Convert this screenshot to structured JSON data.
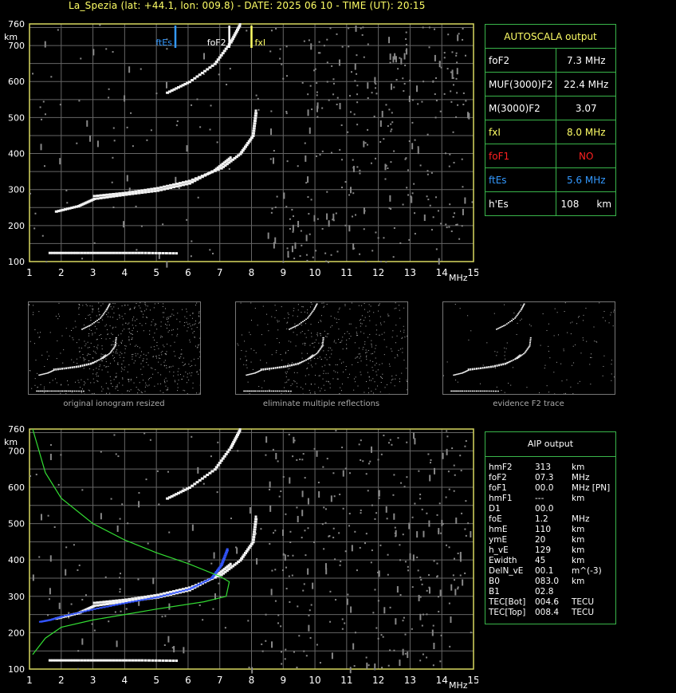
{
  "header": {
    "title": "La_Spezia (lat: +44.1, lon: 009.8) - DATE: 2025 06 10 - TIME (UT): 20:15"
  },
  "autoscala": {
    "heading": "AUTOSCALA output",
    "rows": [
      {
        "label": "foF2",
        "value": "7.3 MHz",
        "color": "#ffffff"
      },
      {
        "label": "MUF(3000)F2",
        "value": "22.4 MHz",
        "color": "#ffffff"
      },
      {
        "label": "M(3000)F2",
        "value": "3.07",
        "color": "#ffffff"
      },
      {
        "label": "fxI",
        "value": "8.0 MHz",
        "color": "#ffff66"
      },
      {
        "label": "foF1",
        "value": "NO",
        "color": "#ff2020"
      },
      {
        "label": "ftEs",
        "value": "5.6 MHz",
        "color": "#3399ff"
      },
      {
        "label": "h'Es",
        "value": "108",
        "unit": "km",
        "color": "#ffffff"
      }
    ]
  },
  "aip": {
    "heading": "AIP output",
    "rows": [
      {
        "name": "hmF2",
        "value": "313",
        "unit": "km"
      },
      {
        "name": "foF2",
        "value": "07.3",
        "unit": "MHz"
      },
      {
        "name": "foF1",
        "value": "00.0",
        "unit": "MHz   [PN]"
      },
      {
        "name": "hmF1",
        "value": "---",
        "unit": "km"
      },
      {
        "name": "D1",
        "value": "00.0",
        "unit": ""
      },
      {
        "name": "foE",
        "value": "1.2",
        "unit": "MHz"
      },
      {
        "name": "hmE",
        "value": "110",
        "unit": "km"
      },
      {
        "name": "ymE",
        "value": "20",
        "unit": "km"
      },
      {
        "name": "h_vE",
        "value": "129",
        "unit": "km"
      },
      {
        "name": "Ewidth",
        "value": "45",
        "unit": "km"
      },
      {
        "name": "DelN_vE",
        "value": "00.1",
        "unit": "m^(-3)"
      },
      {
        "name": "B0",
        "value": "083.0",
        "unit": "km"
      },
      {
        "name": "B1",
        "value": "02.8",
        "unit": ""
      },
      {
        "name": "TEC[Bot]",
        "value": "004.6",
        "unit": "TECU"
      },
      {
        "name": "TEC[Top]",
        "value": "008.4",
        "unit": "TECU"
      }
    ]
  },
  "thumbnails": {
    "captions": [
      "original ionogram resized",
      "eliminate multiple reflections",
      "evidence F2 trace"
    ]
  },
  "chart_data": [
    {
      "type": "scatter",
      "title": "",
      "xlabel": "MHz",
      "ylabel": "km",
      "xlim": [
        1,
        15
      ],
      "ylim": [
        100,
        760
      ],
      "x_ticks": [
        1,
        2,
        3,
        4,
        5,
        6,
        7,
        8,
        9,
        10,
        11,
        12,
        13,
        14,
        15
      ],
      "y_ticks": [
        100,
        200,
        300,
        400,
        500,
        600,
        700,
        760
      ],
      "grid": true,
      "annotations": [
        {
          "label": "ftEs",
          "x": 5.6,
          "color": "#3399ff"
        },
        {
          "label": "foF2",
          "x": 7.3,
          "color": "#ffffff"
        },
        {
          "label": "fxI",
          "x": 8.0,
          "color": "#ffff66"
        }
      ],
      "series": [
        {
          "values": [
            [
              1.6,
              125
            ],
            [
              2.5,
              125
            ],
            [
              3.5,
              125
            ],
            [
              4.5,
              125
            ],
            [
              5.6,
              124
            ]
          ]
        },
        {
          "values": [
            [
              1.8,
              240
            ],
            [
              2.5,
              255
            ],
            [
              3,
              275
            ],
            [
              4,
              287
            ],
            [
              5,
              298
            ],
            [
              6,
              318
            ],
            [
              6.8,
              355
            ],
            [
              7.3,
              390
            ]
          ]
        },
        {
          "values": [
            [
              3,
              283
            ],
            [
              4,
              292
            ],
            [
              5,
              305
            ],
            [
              6,
              325
            ],
            [
              7,
              360
            ],
            [
              7.6,
              400
            ],
            [
              8,
              450
            ],
            [
              8.1,
              520
            ]
          ]
        },
        {
          "values": [
            [
              5.3,
              570
            ],
            [
              6,
              600
            ],
            [
              6.8,
              650
            ],
            [
              7.3,
              710
            ],
            [
              7.6,
              760
            ]
          ]
        }
      ]
    },
    {
      "type": "scatter",
      "title": "",
      "xlabel": "MHz",
      "ylabel": "km",
      "xlim": [
        1,
        15
      ],
      "ylim": [
        100,
        760
      ],
      "x_ticks": [
        1,
        2,
        3,
        4,
        5,
        6,
        7,
        8,
        9,
        10,
        11,
        12,
        13,
        14,
        15
      ],
      "y_ticks": [
        100,
        200,
        300,
        400,
        500,
        600,
        700,
        760
      ],
      "grid": true,
      "series": [
        {
          "values": [
            [
              1.6,
              125
            ],
            [
              2.5,
              125
            ],
            [
              3.5,
              125
            ],
            [
              4.5,
              125
            ],
            [
              5.6,
              124
            ]
          ]
        },
        {
          "values": [
            [
              1.8,
              240
            ],
            [
              2.5,
              255
            ],
            [
              3,
              275
            ],
            [
              4,
              287
            ],
            [
              5,
              298
            ],
            [
              6,
              318
            ],
            [
              6.8,
              355
            ],
            [
              7.3,
              390
            ]
          ]
        },
        {
          "values": [
            [
              3,
              283
            ],
            [
              4,
              292
            ],
            [
              5,
              305
            ],
            [
              6,
              325
            ],
            [
              7,
              360
            ],
            [
              7.6,
              400
            ],
            [
              8,
              450
            ],
            [
              8.1,
              520
            ]
          ]
        },
        {
          "values": [
            [
              5.3,
              570
            ],
            [
              6,
              600
            ],
            [
              6.8,
              650
            ],
            [
              7.3,
              710
            ],
            [
              7.6,
              760
            ]
          ]
        },
        {
          "color": "#3355ff",
          "values": [
            [
              1.3,
              230
            ],
            [
              1.6,
              235
            ],
            [
              2,
              245
            ],
            [
              3,
              265
            ],
            [
              4,
              282
            ],
            [
              5,
              298
            ],
            [
              6,
              320
            ],
            [
              6.7,
              350
            ],
            [
              7,
              385
            ],
            [
              7.2,
              430
            ]
          ]
        },
        {
          "color": "#33dd33",
          "values": [
            [
              1.1,
              760
            ],
            [
              1.5,
              640
            ],
            [
              2,
              570
            ],
            [
              3,
              500
            ],
            [
              4,
              455
            ],
            [
              5,
              420
            ],
            [
              6,
              390
            ],
            [
              7,
              355
            ],
            [
              7.3,
              340
            ],
            [
              7.2,
              300
            ],
            [
              6.5,
              285
            ],
            [
              5,
              265
            ],
            [
              4,
              250
            ],
            [
              3,
              235
            ],
            [
              2,
              215
            ],
            [
              1.5,
              185
            ],
            [
              1.1,
              140
            ]
          ]
        }
      ]
    }
  ]
}
